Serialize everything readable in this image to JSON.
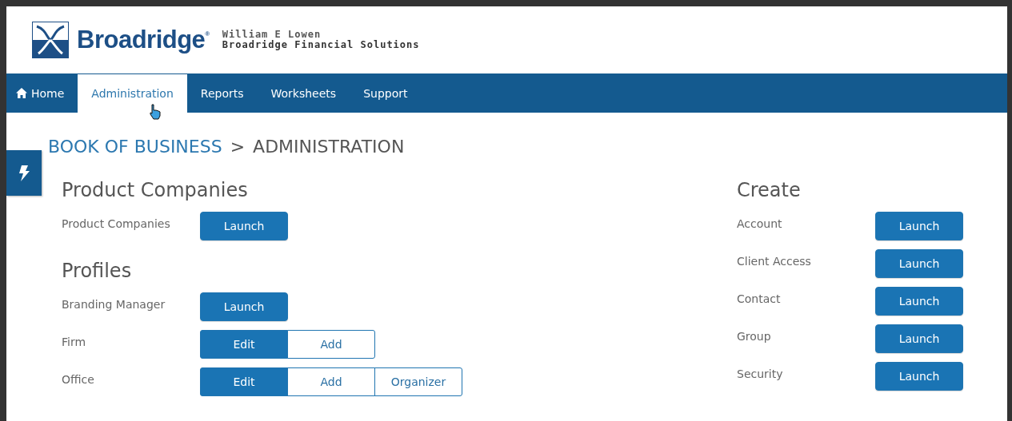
{
  "header": {
    "logo_text": "Broadridge$^{®}$",
    "user_name": "William E Lowen",
    "company": "Broadridge Financial Solutions"
  },
  "nav": [
    {
      "label": "Home",
      "kind": "home",
      "selected": false
    },
    {
      "label": "Administration",
      "kind": "plain",
      "selected": true
    },
    {
      "label": "Reports",
      "kind": "plain",
      "selected": false
    },
    {
      "label": "Worksheets",
      "kind": "plain",
      "selected": false
    },
    {
      "label": "Support",
      "kind": "plain",
      "selected": false
    }
  ],
  "breadcrumb": {
    "link": "BOOK OF BUSINESS",
    "separator": ">",
    "current": "ADMINISTRATION"
  },
  "left_sections": [
    {
      "title": "Product Companies",
      "rows": [
        {
          "label": "Product Companies",
          "kind": "launch",
          "buttons": [
            {
              "label": "Launch",
              "selected": true
            }
          ]
        }
      ]
    },
    {
      "title": "Profiles",
      "rows": [
        {
          "label": "Branding Manager",
          "kind": "launch",
          "buttons": [
            {
              "label": "Launch",
              "selected": true
            }
          ]
        },
        {
          "label": "Firm",
          "kind": "segmented",
          "buttons": [
            {
              "label": "Edit",
              "selected": true
            },
            {
              "label": "Add",
              "selected": false
            }
          ]
        },
        {
          "label": "Office",
          "kind": "segmented",
          "buttons": [
            {
              "label": "Edit",
              "selected": true
            },
            {
              "label": "Add",
              "selected": false
            },
            {
              "label": "Organizer",
              "selected": false
            }
          ]
        }
      ]
    }
  ],
  "right_sections": [
    {
      "title": "Create",
      "rows": [
        {
          "label": "Account",
          "kind": "launch",
          "buttons": [
            {
              "label": "Launch",
              "selected": true
            }
          ]
        },
        {
          "label": "Client Access",
          "kind": "launch",
          "buttons": [
            {
              "label": "Launch",
              "selected": true
            }
          ]
        },
        {
          "label": "Contact",
          "kind": "launch",
          "buttons": [
            {
              "label": "Launch",
              "selected": true
            }
          ]
        },
        {
          "label": "Group",
          "kind": "launch",
          "buttons": [
            {
              "label": "Launch",
              "selected": true
            }
          ]
        },
        {
          "label": "Security",
          "kind": "launch",
          "buttons": [
            {
              "label": "Launch",
              "selected": true
            }
          ]
        }
      ]
    }
  ]
}
